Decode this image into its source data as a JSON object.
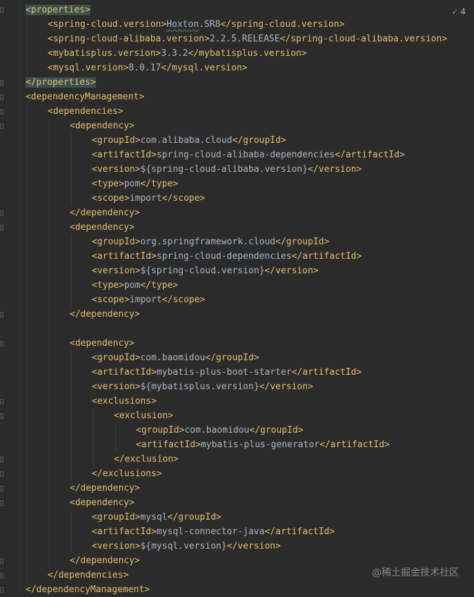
{
  "inspection": {
    "icon": "check-icon",
    "count": "4"
  },
  "watermark": "@稀土掘金技术社区",
  "colors": {
    "tag": "#e8bf6a",
    "text": "#a9b7c6",
    "background": "#2b2b2b",
    "highlight": "#3b514d"
  },
  "lines": [
    {
      "indent": 0,
      "segments": [
        {
          "text": "<properties>",
          "type": "hl"
        }
      ]
    },
    {
      "indent": 1,
      "segments": [
        {
          "text": "<spring-cloud.version>",
          "type": "t"
        },
        {
          "text": "Hoxton",
          "type": "sq"
        },
        {
          "text": ".SR8",
          "type": "v"
        },
        {
          "text": "</spring-cloud.version>",
          "type": "t"
        }
      ]
    },
    {
      "indent": 1,
      "segments": [
        {
          "text": "<spring-cloud-alibaba.version>",
          "type": "t"
        },
        {
          "text": "2.2.5.RELEASE",
          "type": "v"
        },
        {
          "text": "</spring-cloud-alibaba.version>",
          "type": "t"
        }
      ]
    },
    {
      "indent": 1,
      "segments": [
        {
          "text": "<mybatisplus.version>",
          "type": "t"
        },
        {
          "text": "3.3.2",
          "type": "v"
        },
        {
          "text": "</mybatisplus.version>",
          "type": "t"
        }
      ]
    },
    {
      "indent": 1,
      "segments": [
        {
          "text": "<mysql.version>",
          "type": "t"
        },
        {
          "text": "8.0.17",
          "type": "v"
        },
        {
          "text": "</mysql.version>",
          "type": "t"
        }
      ]
    },
    {
      "indent": 0,
      "segments": [
        {
          "text": "</properties>",
          "type": "hl"
        }
      ]
    },
    {
      "indent": 0,
      "segments": [
        {
          "text": "<dependencyManagement>",
          "type": "t"
        }
      ]
    },
    {
      "indent": 1,
      "segments": [
        {
          "text": "<dependencies>",
          "type": "t"
        }
      ]
    },
    {
      "indent": 2,
      "segments": [
        {
          "text": "<dependency>",
          "type": "t"
        }
      ]
    },
    {
      "indent": 3,
      "segments": [
        {
          "text": "<groupId>",
          "type": "t"
        },
        {
          "text": "com.alibaba.cloud",
          "type": "v"
        },
        {
          "text": "</groupId>",
          "type": "t"
        }
      ]
    },
    {
      "indent": 3,
      "segments": [
        {
          "text": "<artifactId>",
          "type": "t"
        },
        {
          "text": "spring-cloud-alibaba-dependencies",
          "type": "v"
        },
        {
          "text": "</artifactId>",
          "type": "t"
        }
      ]
    },
    {
      "indent": 3,
      "segments": [
        {
          "text": "<version>",
          "type": "t"
        },
        {
          "text": "${spring-cloud-alibaba.version}",
          "type": "v"
        },
        {
          "text": "</version>",
          "type": "t"
        }
      ]
    },
    {
      "indent": 3,
      "segments": [
        {
          "text": "<type>",
          "type": "t"
        },
        {
          "text": "pom",
          "type": "v"
        },
        {
          "text": "</type>",
          "type": "t"
        }
      ]
    },
    {
      "indent": 3,
      "segments": [
        {
          "text": "<scope>",
          "type": "t"
        },
        {
          "text": "import",
          "type": "v"
        },
        {
          "text": "</scope>",
          "type": "t"
        }
      ]
    },
    {
      "indent": 2,
      "segments": [
        {
          "text": "</dependency>",
          "type": "t"
        }
      ]
    },
    {
      "indent": 2,
      "segments": [
        {
          "text": "<dependency>",
          "type": "t"
        }
      ]
    },
    {
      "indent": 3,
      "segments": [
        {
          "text": "<groupId>",
          "type": "t"
        },
        {
          "text": "org.springframework.cloud",
          "type": "v"
        },
        {
          "text": "</groupId>",
          "type": "t"
        }
      ]
    },
    {
      "indent": 3,
      "segments": [
        {
          "text": "<artifactId>",
          "type": "t"
        },
        {
          "text": "spring-cloud-dependencies",
          "type": "v"
        },
        {
          "text": "</artifactId>",
          "type": "t"
        }
      ]
    },
    {
      "indent": 3,
      "segments": [
        {
          "text": "<version>",
          "type": "t"
        },
        {
          "text": "${spring-cloud.version}",
          "type": "v"
        },
        {
          "text": "</version>",
          "type": "t"
        }
      ]
    },
    {
      "indent": 3,
      "segments": [
        {
          "text": "<type>",
          "type": "t"
        },
        {
          "text": "pom",
          "type": "v"
        },
        {
          "text": "</type>",
          "type": "t"
        }
      ]
    },
    {
      "indent": 3,
      "segments": [
        {
          "text": "<scope>",
          "type": "t"
        },
        {
          "text": "import",
          "type": "v"
        },
        {
          "text": "</scope>",
          "type": "t"
        }
      ]
    },
    {
      "indent": 2,
      "segments": [
        {
          "text": "</dependency>",
          "type": "t"
        }
      ]
    },
    {
      "indent": 0,
      "segments": []
    },
    {
      "indent": 2,
      "segments": [
        {
          "text": "<dependency>",
          "type": "t"
        }
      ]
    },
    {
      "indent": 3,
      "segments": [
        {
          "text": "<groupId>",
          "type": "t"
        },
        {
          "text": "com.baomidou",
          "type": "v"
        },
        {
          "text": "</groupId>",
          "type": "t"
        }
      ]
    },
    {
      "indent": 3,
      "segments": [
        {
          "text": "<artifactId>",
          "type": "t"
        },
        {
          "text": "mybatis-plus-boot-starter",
          "type": "v"
        },
        {
          "text": "</artifactId>",
          "type": "t"
        }
      ]
    },
    {
      "indent": 3,
      "segments": [
        {
          "text": "<version>",
          "type": "t"
        },
        {
          "text": "${mybatisplus.version}",
          "type": "v"
        },
        {
          "text": "</version>",
          "type": "t"
        }
      ]
    },
    {
      "indent": 3,
      "segments": [
        {
          "text": "<exclusions>",
          "type": "t"
        }
      ]
    },
    {
      "indent": 4,
      "segments": [
        {
          "text": "<exclusion>",
          "type": "t"
        }
      ]
    },
    {
      "indent": 5,
      "segments": [
        {
          "text": "<groupId>",
          "type": "t"
        },
        {
          "text": "com.baomidou",
          "type": "v"
        },
        {
          "text": "</groupId>",
          "type": "t"
        }
      ]
    },
    {
      "indent": 5,
      "segments": [
        {
          "text": "<artifactId>",
          "type": "t"
        },
        {
          "text": "mybatis-plus-generator",
          "type": "v"
        },
        {
          "text": "</artifactId>",
          "type": "t"
        }
      ]
    },
    {
      "indent": 4,
      "segments": [
        {
          "text": "</exclusion>",
          "type": "t"
        }
      ]
    },
    {
      "indent": 3,
      "segments": [
        {
          "text": "</exclusions>",
          "type": "t"
        }
      ]
    },
    {
      "indent": 2,
      "segments": [
        {
          "text": "</dependency>",
          "type": "t"
        }
      ]
    },
    {
      "indent": 2,
      "segments": [
        {
          "text": "<dependency>",
          "type": "t"
        }
      ]
    },
    {
      "indent": 3,
      "segments": [
        {
          "text": "<groupId>",
          "type": "t"
        },
        {
          "text": "mysql",
          "type": "v"
        },
        {
          "text": "</groupId>",
          "type": "t"
        }
      ]
    },
    {
      "indent": 3,
      "segments": [
        {
          "text": "<artifactId>",
          "type": "t"
        },
        {
          "text": "mysql-connector-java",
          "type": "v"
        },
        {
          "text": "</artifactId>",
          "type": "t"
        }
      ]
    },
    {
      "indent": 3,
      "segments": [
        {
          "text": "<version>",
          "type": "t"
        },
        {
          "text": "${mysql.version}",
          "type": "v"
        },
        {
          "text": "</version>",
          "type": "t"
        }
      ]
    },
    {
      "indent": 2,
      "segments": [
        {
          "text": "</dependency>",
          "type": "t"
        }
      ]
    },
    {
      "indent": 1,
      "segments": [
        {
          "text": "</dependencies>",
          "type": "t"
        }
      ]
    },
    {
      "indent": 0,
      "segments": [
        {
          "text": "</dependencyManagement>",
          "type": "t"
        }
      ]
    }
  ]
}
